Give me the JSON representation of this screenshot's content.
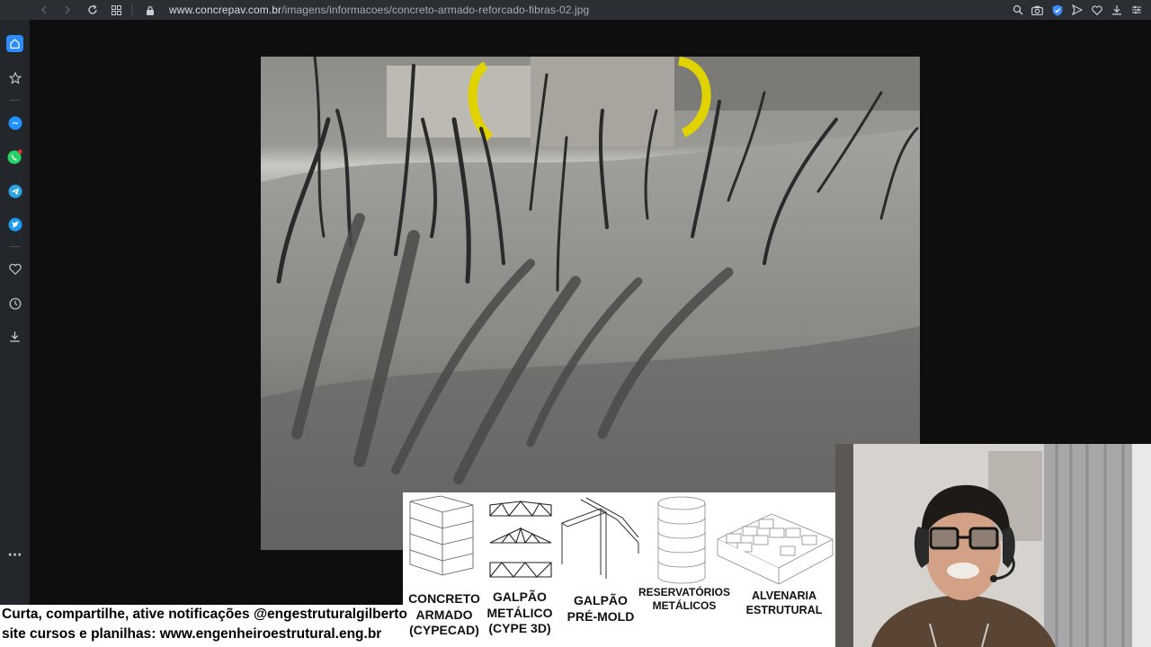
{
  "browser": {
    "url_host": "www.concrepav.com.br",
    "url_path": "/imagens/informacoes/concreto-armado-reforcado-fibras-02.jpg",
    "toolbar_icons": [
      "back-icon",
      "forward-icon",
      "reload-icon",
      "tiles-icon",
      "lock-icon"
    ],
    "right_icons": [
      "zoom-icon",
      "camera-icon",
      "shield-icon",
      "send-icon",
      "heart-icon",
      "download-icon",
      "settings-icon"
    ]
  },
  "sidebar": {
    "items": [
      "home-icon",
      "star-icon",
      "messenger-icon",
      "whatsapp-icon",
      "telegram-icon",
      "twitter-icon",
      "heart-icon",
      "history-icon",
      "download-icon",
      "more-icon"
    ],
    "more_label": "···"
  },
  "overlay": {
    "items": [
      {
        "lines": [
          "CONCRETO",
          "ARMADO",
          "(CYPECAD)"
        ]
      },
      {
        "lines": [
          "GALPÃO",
          "METÁLICO",
          "(CYPE 3D)"
        ]
      },
      {
        "lines": [
          "GALPÃO",
          "PRÉ-MOLD"
        ]
      },
      {
        "lines": [
          "RESERVATÓRIOS",
          "METÁLICOS"
        ]
      },
      {
        "lines": [
          "ALVENARIA",
          "ESTRUTURAL"
        ]
      }
    ]
  },
  "caption": {
    "line1": "Curta, compartilhe, ative notificações @engestruturalgilberto",
    "line2": "site cursos e planilhas: www.engenheiroestrutural.eng.br"
  },
  "colors": {
    "browser_bar": "#2b2e33",
    "sidebar": "#23262a",
    "accent_blue": "#2b8cff",
    "whatsapp": "#25d366",
    "telegram": "#2aa3e0",
    "twitter": "#1d9bf0",
    "messenger": "#1e90ff"
  }
}
